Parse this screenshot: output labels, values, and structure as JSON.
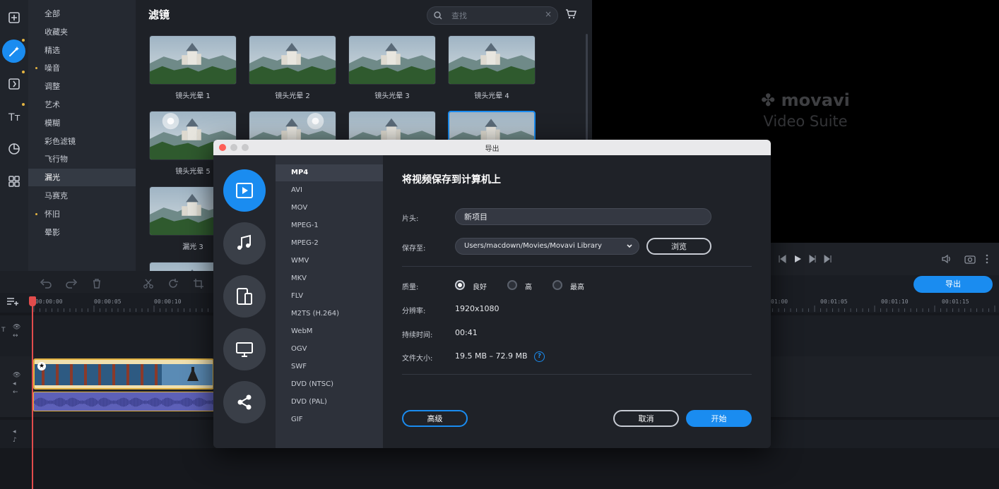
{
  "sidebar": {
    "categories": [
      {
        "label": "全部",
        "dot": false
      },
      {
        "label": "收藏夹",
        "dot": false
      },
      {
        "label": "精选",
        "dot": false
      },
      {
        "label": "噪音",
        "dot": true
      },
      {
        "label": "调整",
        "dot": false
      },
      {
        "label": "艺术",
        "dot": false
      },
      {
        "label": "模糊",
        "dot": false
      },
      {
        "label": "彩色滤镜",
        "dot": false
      },
      {
        "label": "飞行物",
        "dot": false
      },
      {
        "label": "漏光",
        "dot": false,
        "selected": true
      },
      {
        "label": "马赛克",
        "dot": false
      },
      {
        "label": "怀旧",
        "dot": true
      },
      {
        "label": "晕影",
        "dot": false
      }
    ]
  },
  "filters": {
    "title": "滤镜",
    "search_placeholder": "查找",
    "thumbnails": [
      {
        "label": "镜头光晕 1"
      },
      {
        "label": "镜头光晕 2"
      },
      {
        "label": "镜头光晕 3"
      },
      {
        "label": "镜头光晕 4"
      },
      {
        "label": "镜头光晕 5"
      },
      {
        "label": "漏光 3"
      }
    ]
  },
  "preview": {
    "brand": "movavi",
    "product": "Video Suite"
  },
  "toolbar": {
    "export_label": "导出"
  },
  "timeline": {
    "ruler_left": [
      "00:00:00",
      "00:00:05",
      "00:00:10"
    ],
    "ruler_right": [
      "01:00",
      "00:01:05",
      "00:01:10",
      "00:01:15"
    ]
  },
  "export_dialog": {
    "window_title": "导出",
    "heading": "将视频保存到计算机上",
    "formats": [
      "MP4",
      "AVI",
      "MOV",
      "MPEG-1",
      "MPEG-2",
      "WMV",
      "MKV",
      "FLV",
      "M2TS (H.264)",
      "WebM",
      "OGV",
      "SWF",
      "DVD (NTSC)",
      "DVD (PAL)",
      "GIF"
    ],
    "selected_format": "MP4",
    "title_label": "片头:",
    "title_value": "新项目",
    "save_label": "保存至:",
    "save_path": "Users/macdown/Movies/Movavi Library",
    "browse_label": "浏览",
    "quality_label": "质量:",
    "quality_options": [
      "良好",
      "高",
      "最高"
    ],
    "quality_selected": "良好",
    "resolution_label": "分辨率:",
    "resolution_value": "1920x1080",
    "duration_label": "持续时间:",
    "duration_value": "00:41",
    "filesize_label": "文件大小:",
    "filesize_value": "19.5 MB – 72.9 MB",
    "advanced_label": "高级",
    "cancel_label": "取消",
    "start_label": "开始"
  },
  "colors": {
    "accent": "#1a8cf0",
    "clip_border": "#e3b341",
    "playhead": "#e24c4c"
  }
}
